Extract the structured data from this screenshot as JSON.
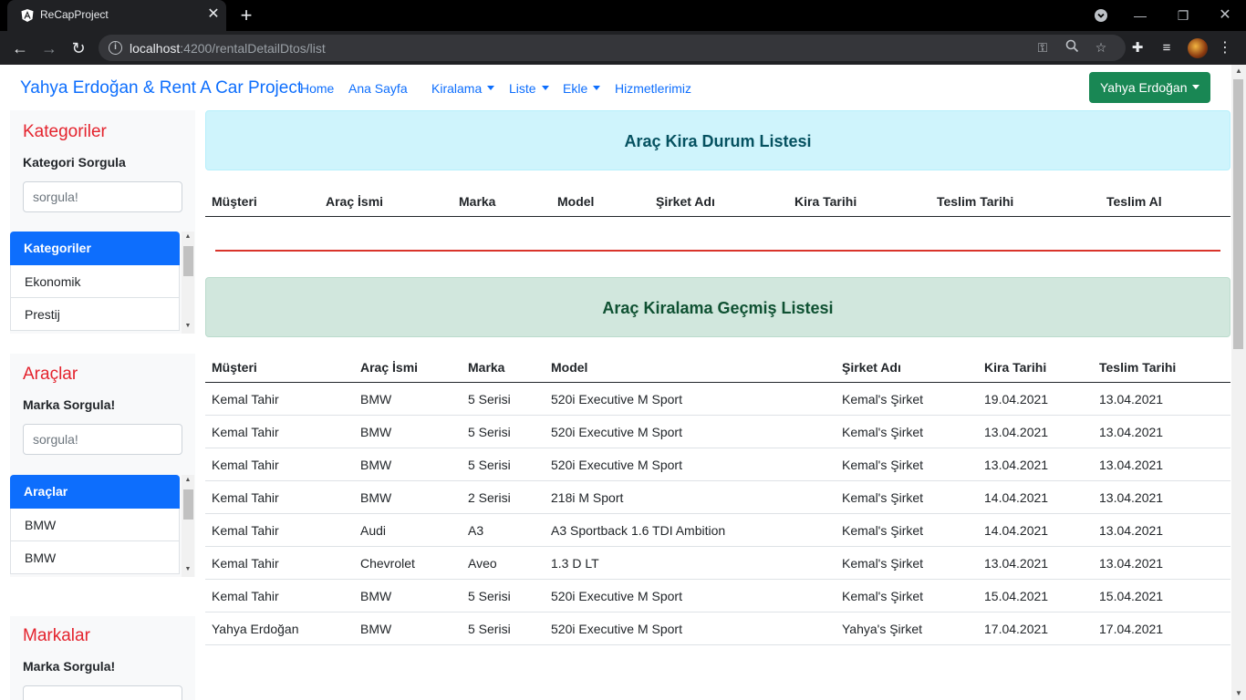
{
  "browser": {
    "tab_title": "ReCapProject",
    "url_host": "localhost",
    "url_path": ":4200/rentalDetailDtos/list"
  },
  "navbar": {
    "brand": "Yahya Erdoğan & Rent A Car Project",
    "links": [
      "Home",
      "Ana Sayfa"
    ],
    "dropdowns": [
      "Kiralama",
      "Liste",
      "Ekle"
    ],
    "services": "Hizmetlerimiz",
    "user_button": "Yahya Erdoğan"
  },
  "sidebar": {
    "categories": {
      "title": "Kategoriler",
      "subtitle": "Kategori Sorgula",
      "placeholder": "sorgula!",
      "header": "Kategoriler",
      "items": [
        "Ekonomik",
        "Prestij"
      ]
    },
    "cars": {
      "title": "Araçlar",
      "subtitle": "Marka Sorgula!",
      "placeholder": "sorgula!",
      "header": "Araçlar",
      "items": [
        "BMW",
        "BMW"
      ]
    },
    "brands": {
      "title": "Markalar",
      "subtitle": "Marka Sorgula!"
    }
  },
  "status_panel": {
    "title": "Araç Kira Durum Listesi",
    "headers": [
      "Müşteri",
      "Araç İsmi",
      "Marka",
      "Model",
      "Şirket Adı",
      "Kira Tarihi",
      "Teslim Tarihi",
      "Teslim Al"
    ]
  },
  "history_panel": {
    "title": "Araç Kiralama Geçmiş Listesi",
    "headers": [
      "Müşteri",
      "Araç İsmi",
      "Marka",
      "Model",
      "Şirket Adı",
      "Kira Tarihi",
      "Teslim Tarihi"
    ],
    "rows": [
      [
        "Kemal Tahir",
        "BMW",
        "5 Serisi",
        "520i Executive M Sport",
        "Kemal's Şirket",
        "19.04.2021",
        "13.04.2021"
      ],
      [
        "Kemal Tahir",
        "BMW",
        "5 Serisi",
        "520i Executive M Sport",
        "Kemal's Şirket",
        "13.04.2021",
        "13.04.2021"
      ],
      [
        "Kemal Tahir",
        "BMW",
        "5 Serisi",
        "520i Executive M Sport",
        "Kemal's Şirket",
        "13.04.2021",
        "13.04.2021"
      ],
      [
        "Kemal Tahir",
        "BMW",
        "2 Serisi",
        "218i M Sport",
        "Kemal's Şirket",
        "14.04.2021",
        "13.04.2021"
      ],
      [
        "Kemal Tahir",
        "Audi",
        "A3",
        "A3 Sportback 1.6 TDI Ambition",
        "Kemal's Şirket",
        "14.04.2021",
        "13.04.2021"
      ],
      [
        "Kemal Tahir",
        "Chevrolet",
        "Aveo",
        "1.3 D LT",
        "Kemal's Şirket",
        "13.04.2021",
        "13.04.2021"
      ],
      [
        "Kemal Tahir",
        "BMW",
        "5 Serisi",
        "520i Executive M Sport",
        "Kemal's Şirket",
        "15.04.2021",
        "15.04.2021"
      ],
      [
        "Yahya Erdoğan",
        "BMW",
        "5 Serisi",
        "520i Executive M Sport",
        "Yahya's Şirket",
        "17.04.2021",
        "17.04.2021"
      ]
    ]
  },
  "colors": {
    "primary": "#0d6efd",
    "success": "#198754",
    "danger_title": "#e4232d",
    "info_bg": "#cff4fc",
    "success_bg": "#d1e7dd"
  }
}
